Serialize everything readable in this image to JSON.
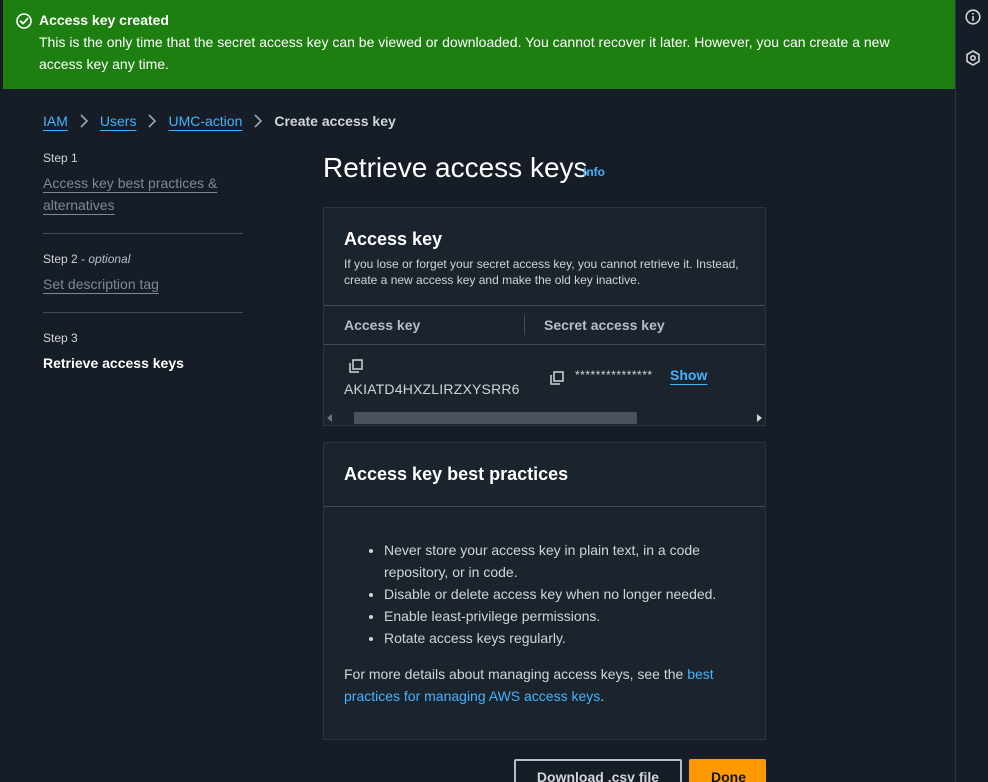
{
  "flash": {
    "title": "Access key created",
    "message": "This is the only time that the secret access key can be viewed or downloaded. You cannot recover it later. However, you can create a new access key any time.",
    "icon": "check-circle-icon",
    "color": "#1e7f11"
  },
  "breadcrumb": {
    "items": [
      "IAM",
      "Users",
      "UMC-action"
    ],
    "current": "Create access key"
  },
  "steps": [
    {
      "num": "Step 1",
      "optional": "",
      "label": "Access key best practices & alternatives"
    },
    {
      "num": "Step 2 - ",
      "optional": "optional",
      "label": "Set description tag"
    },
    {
      "num": "Step 3",
      "optional": "",
      "label": "Retrieve access keys"
    }
  ],
  "page": {
    "title": "Retrieve access keys",
    "info": "Info"
  },
  "access_key_panel": {
    "title": "Access key",
    "description": "If you lose or forget your secret access key, you cannot retrieve it. Instead, create a new access key and make the old key inactive.",
    "columns": [
      "Access key",
      "Secret access key"
    ],
    "access_key": "AKIATD4HXZLIRZXYSRR6",
    "secret_masked": "***************",
    "show_label": "Show"
  },
  "best_practices": {
    "title": "Access key best practices",
    "items": [
      "Never store your access key in plain text, in a code repository, or in code.",
      "Disable or delete access key when no longer needed.",
      "Enable least-privilege permissions.",
      "Rotate access keys regularly."
    ],
    "footer_prefix": "For more details about managing access keys, see the ",
    "footer_link": "best practices for managing AWS access keys",
    "footer_suffix": "."
  },
  "buttons": {
    "download": "Download .csv file",
    "done": "Done"
  },
  "rail": {
    "icons": [
      "info-icon",
      "settings-hex-icon"
    ]
  },
  "colors": {
    "accent_link": "#42b4ff",
    "primary_button": "#ff9900",
    "background": "#161d26"
  }
}
